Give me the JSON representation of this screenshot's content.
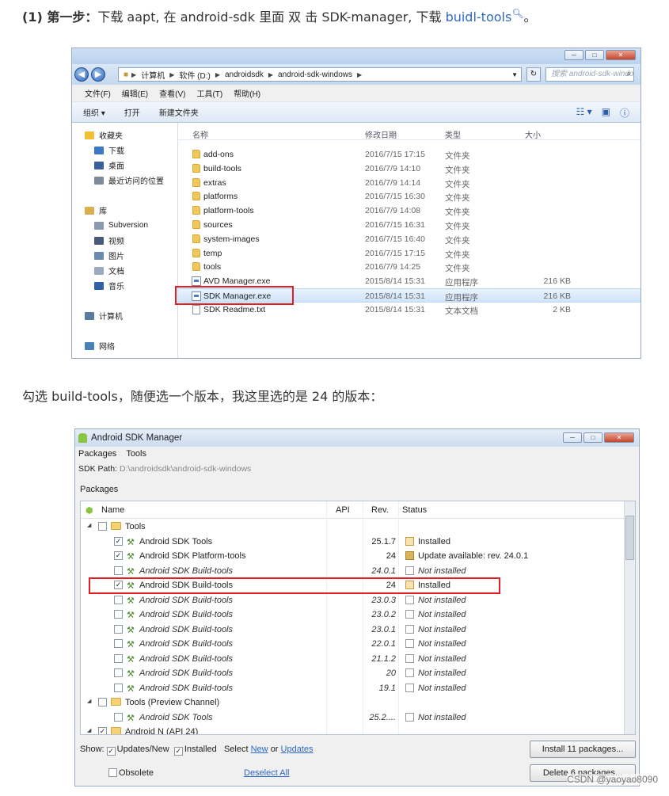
{
  "step1": {
    "num": "(1) 第一步：",
    "text": "下载 aapt, 在 android-sdk 里面 双 击 SDK-manager, 下载 ",
    "link": "buidl-tools",
    "end": "。"
  },
  "explorer": {
    "crumbs": [
      "计算机",
      "软件 (D:)",
      "androidsdk",
      "android-sdk-windows"
    ],
    "search_placeholder": "搜索 android-sdk-windows",
    "menu": [
      "文件(F)",
      "编辑(E)",
      "查看(V)",
      "工具(T)",
      "帮助(H)"
    ],
    "toolbar": [
      "组织 ▾",
      "打开",
      "新建文件夹"
    ],
    "nav": [
      {
        "label": "收藏夹",
        "color": "#f0c030"
      },
      {
        "label": "下载",
        "color": "#3c78c8"
      },
      {
        "label": "桌面",
        "color": "#3a5f9a"
      },
      {
        "label": "最近访问的位置",
        "color": "#7a8a9a"
      },
      {
        "label": "",
        "color": ""
      },
      {
        "label": "库",
        "color": "#d8b050"
      },
      {
        "label": "Subversion",
        "color": "#8a9ab0"
      },
      {
        "label": "视频",
        "color": "#4a5a7a"
      },
      {
        "label": "图片",
        "color": "#6a8ab0"
      },
      {
        "label": "文档",
        "color": "#9aaac0"
      },
      {
        "label": "音乐",
        "color": "#3060a8"
      },
      {
        "label": "",
        "color": ""
      },
      {
        "label": "计算机",
        "color": "#5a7aa0"
      },
      {
        "label": "",
        "color": ""
      },
      {
        "label": "网络",
        "color": "#4a80b8"
      }
    ],
    "columns": [
      "名称",
      "修改日期",
      "类型",
      "大小"
    ],
    "files": [
      {
        "name": "add-ons",
        "date": "2016/7/15 17:15",
        "type": "文件夹",
        "size": "",
        "kind": "folder"
      },
      {
        "name": "build-tools",
        "date": "2016/7/9 14:10",
        "type": "文件夹",
        "size": "",
        "kind": "folder"
      },
      {
        "name": "extras",
        "date": "2016/7/9 14:14",
        "type": "文件夹",
        "size": "",
        "kind": "folder"
      },
      {
        "name": "platforms",
        "date": "2016/7/15 16:30",
        "type": "文件夹",
        "size": "",
        "kind": "folder"
      },
      {
        "name": "platform-tools",
        "date": "2016/7/9 14:08",
        "type": "文件夹",
        "size": "",
        "kind": "folder"
      },
      {
        "name": "sources",
        "date": "2016/7/15 16:31",
        "type": "文件夹",
        "size": "",
        "kind": "folder"
      },
      {
        "name": "system-images",
        "date": "2016/7/15 16:40",
        "type": "文件夹",
        "size": "",
        "kind": "folder"
      },
      {
        "name": "temp",
        "date": "2016/7/15 17:15",
        "type": "文件夹",
        "size": "",
        "kind": "folder"
      },
      {
        "name": "tools",
        "date": "2016/7/9 14:25",
        "type": "文件夹",
        "size": "",
        "kind": "folder"
      },
      {
        "name": "AVD Manager.exe",
        "date": "2015/8/14 15:31",
        "type": "应用程序",
        "size": "216 KB",
        "kind": "exe"
      },
      {
        "name": "SDK Manager.exe",
        "date": "2015/8/14 15:31",
        "type": "应用程序",
        "size": "216 KB",
        "kind": "exe",
        "selected": true
      },
      {
        "name": "SDK Readme.txt",
        "date": "2015/8/14 15:31",
        "type": "文本文档",
        "size": "2 KB",
        "kind": "txt"
      }
    ]
  },
  "step2": "勾选 build-tools，随便选一个版本，我这里选的是 24 的版本：",
  "sdk": {
    "title": "Android SDK Manager",
    "menu": [
      "Packages",
      "Tools"
    ],
    "path_label": "SDK Path:",
    "path_value": "D:\\androidsdk\\android-sdk-windows",
    "packages_label": "Packages",
    "columns": [
      "Name",
      "API",
      "Rev.",
      "Status"
    ],
    "rows": [
      {
        "level": 0,
        "checked": false,
        "icon": "folder",
        "name": "Tools",
        "api": "",
        "rev": "",
        "status": "",
        "italic": false,
        "st": ""
      },
      {
        "level": 1,
        "checked": true,
        "icon": "wrench",
        "name": "Android SDK Tools",
        "api": "",
        "rev": "25.1.7",
        "status": "Installed",
        "italic": false,
        "st": "inst"
      },
      {
        "level": 1,
        "checked": true,
        "icon": "wrench",
        "name": "Android SDK Platform-tools",
        "api": "",
        "rev": "24",
        "status": "Update available: rev. 24.0.1",
        "italic": false,
        "st": "upd"
      },
      {
        "level": 1,
        "checked": false,
        "icon": "wrench",
        "name": "Android SDK Build-tools",
        "api": "",
        "rev": "24.0.1",
        "status": "Not installed",
        "italic": true,
        "st": "none"
      },
      {
        "level": 1,
        "checked": true,
        "icon": "wrench",
        "name": "Android SDK Build-tools",
        "api": "",
        "rev": "24",
        "status": "Installed",
        "italic": false,
        "st": "inst",
        "highlight": true
      },
      {
        "level": 1,
        "checked": false,
        "icon": "wrench",
        "name": "Android SDK Build-tools",
        "api": "",
        "rev": "23.0.3",
        "status": "Not installed",
        "italic": true,
        "st": "none"
      },
      {
        "level": 1,
        "checked": false,
        "icon": "wrench",
        "name": "Android SDK Build-tools",
        "api": "",
        "rev": "23.0.2",
        "status": "Not installed",
        "italic": true,
        "st": "none"
      },
      {
        "level": 1,
        "checked": false,
        "icon": "wrench",
        "name": "Android SDK Build-tools",
        "api": "",
        "rev": "23.0.1",
        "status": "Not installed",
        "italic": true,
        "st": "none"
      },
      {
        "level": 1,
        "checked": false,
        "icon": "wrench",
        "name": "Android SDK Build-tools",
        "api": "",
        "rev": "22.0.1",
        "status": "Not installed",
        "italic": true,
        "st": "none"
      },
      {
        "level": 1,
        "checked": false,
        "icon": "wrench",
        "name": "Android SDK Build-tools",
        "api": "",
        "rev": "21.1.2",
        "status": "Not installed",
        "italic": true,
        "st": "none"
      },
      {
        "level": 1,
        "checked": false,
        "icon": "wrench",
        "name": "Android SDK Build-tools",
        "api": "",
        "rev": "20",
        "status": "Not installed",
        "italic": true,
        "st": "none"
      },
      {
        "level": 1,
        "checked": false,
        "icon": "wrench",
        "name": "Android SDK Build-tools",
        "api": "",
        "rev": "19.1",
        "status": "Not installed",
        "italic": true,
        "st": "none"
      },
      {
        "level": 0,
        "checked": false,
        "icon": "folder",
        "name": "Tools (Preview Channel)",
        "api": "",
        "rev": "",
        "status": "",
        "italic": false,
        "st": ""
      },
      {
        "level": 1,
        "checked": false,
        "icon": "wrench",
        "name": "Android SDK Tools",
        "api": "",
        "rev": "25.2....",
        "status": "Not installed",
        "italic": true,
        "st": "none"
      },
      {
        "level": 0,
        "checked": true,
        "icon": "folder",
        "name": "Android N (API 24)",
        "api": "",
        "rev": "",
        "status": "",
        "italic": false,
        "st": ""
      }
    ],
    "show_label": "Show:",
    "updates_new": "Updates/New",
    "installed": "Installed",
    "select_label": "Select",
    "new_link": "New",
    "or": "or",
    "updates_link": "Updates",
    "obsolete": "Obsolete",
    "deselect_all": "Deselect All",
    "install_btn": "Install 11 packages...",
    "delete_btn": "Delete 6 packages..."
  },
  "watermark": "CSDN @yaoyao8090"
}
